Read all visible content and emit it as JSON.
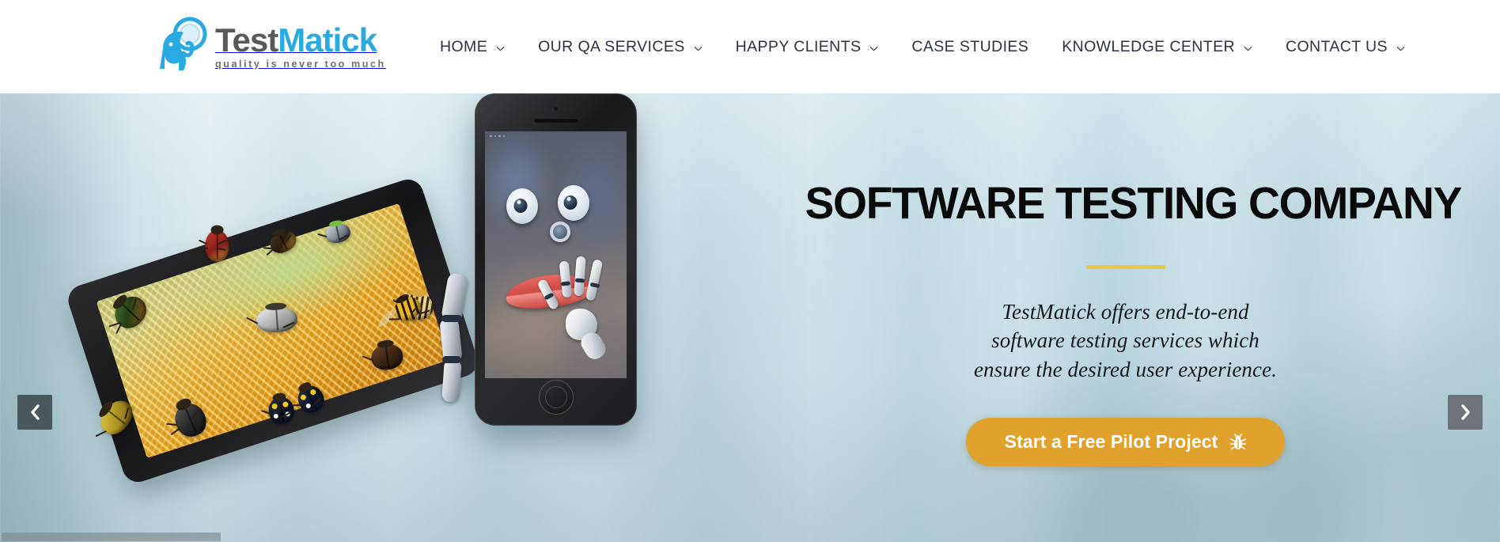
{
  "brand": {
    "name_part1": "Test",
    "name_part2": "Matick",
    "tagline": "quality is never too much",
    "logo_icon": "elephant-magnifier-logo",
    "color_gray": "#58595b",
    "color_blue": "#29abe2"
  },
  "nav": {
    "items": [
      {
        "label": "HOME",
        "has_dropdown": true
      },
      {
        "label": "OUR QA SERVICES",
        "has_dropdown": true
      },
      {
        "label": "HAPPY CLIENTS",
        "has_dropdown": true
      },
      {
        "label": "CASE STUDIES",
        "has_dropdown": false
      },
      {
        "label": "KNOWLEDGE CENTER",
        "has_dropdown": true
      },
      {
        "label": "CONTACT US",
        "has_dropdown": true
      }
    ]
  },
  "hero": {
    "title": "SOFTWARE TESTING COMPANY",
    "subtitle_line1": "TestMatick offers end-to-end",
    "subtitle_line2": "software testing services which",
    "subtitle_line3": "ensure the desired user experience.",
    "cta_label": "Start a Free Pilot Project",
    "cta_icon": "bug-icon",
    "cta_color": "#e0a12d",
    "divider_color": "#e9c84b",
    "prev_icon": "chevron-left-icon",
    "next_icon": "chevron-right-icon",
    "illustration_tablet": "tablet-with-beetles",
    "illustration_phone": "smartphone-with-cartoon-face-and-robot-hand",
    "background": "blurred-office-interior"
  },
  "scrollbar": {
    "orientation": "horizontal",
    "thumb_label": "horizontal-scroll-thumb"
  }
}
